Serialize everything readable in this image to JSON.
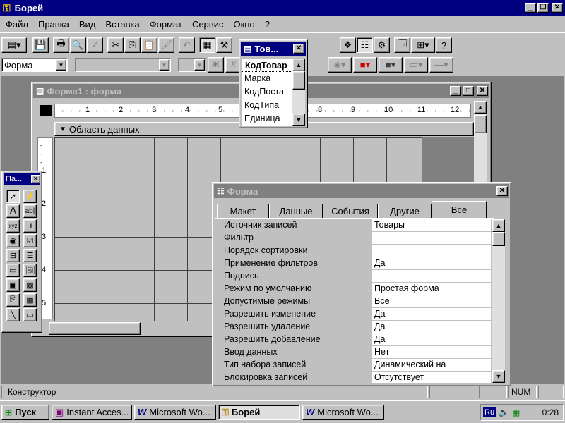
{
  "app": {
    "title": "Борей"
  },
  "menu": {
    "file": "Файл",
    "edit": "Правка",
    "view": "Вид",
    "insert": "Вставка",
    "format": "Формат",
    "service": "Сервис",
    "window": "Окно",
    "help": "?"
  },
  "formatting": {
    "object_value": "Форма",
    "bold": "Ж",
    "italic": "К"
  },
  "form_window": {
    "title": "Форма1 : форма",
    "section": "Область данных",
    "ruler": [
      "1",
      "2",
      "3",
      "4",
      "5",
      "8",
      "9",
      "10",
      "11",
      "12"
    ],
    "vruler": [
      "1",
      "2",
      "3",
      "4",
      "5"
    ]
  },
  "field_list": {
    "title": "Тов...",
    "items": [
      "КодТовар",
      "Марка",
      "КодПоста",
      "КодТипа",
      "Единица"
    ]
  },
  "toolbox": {
    "title": "Па..."
  },
  "props": {
    "title": "Форма",
    "tabs": [
      "Макет",
      "Данные",
      "События",
      "Другие",
      "Все"
    ],
    "rows": [
      {
        "name": "Источник записей",
        "value": "Товары"
      },
      {
        "name": "Фильтр",
        "value": ""
      },
      {
        "name": "Порядок сортировки",
        "value": ""
      },
      {
        "name": "Применение фильтров",
        "value": "Да"
      },
      {
        "name": "Подпись",
        "value": ""
      },
      {
        "name": "Режим по умолчанию",
        "value": "Простая форма"
      },
      {
        "name": "Допустимые режимы",
        "value": "Все"
      },
      {
        "name": "Разрешить изменение",
        "value": "Да"
      },
      {
        "name": "Разрешить удаление",
        "value": "Да"
      },
      {
        "name": "Разрешить добавление",
        "value": "Да"
      },
      {
        "name": "Ввод данных",
        "value": "Нет"
      },
      {
        "name": "Тип набора записей",
        "value": "Динамический на"
      },
      {
        "name": "Блокировка записей",
        "value": "Отсутствует"
      }
    ]
  },
  "status": {
    "mode": "Конструктор",
    "num": "NUM"
  },
  "taskbar": {
    "start": "Пуск",
    "tasks": [
      "Instant Acces...",
      "Microsoft Wo...",
      "Борей",
      "Microsoft Wo..."
    ],
    "lang": "Ru",
    "time": "0:28"
  }
}
